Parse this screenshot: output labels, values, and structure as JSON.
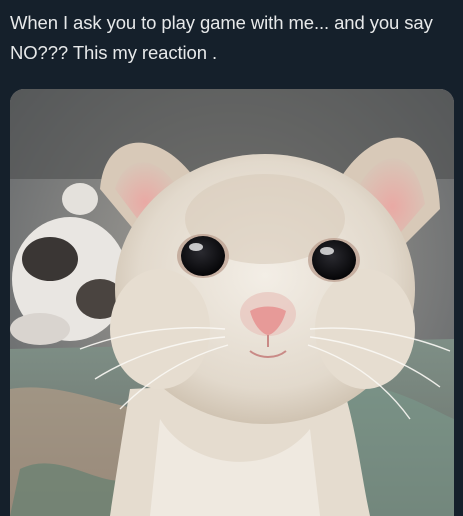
{
  "post": {
    "text": "When I ask you to play game with me... and you say NO??? This my reaction ."
  },
  "media": {
    "subject": "crying-kitten-photo",
    "alt": "",
    "colors": {
      "background": "#15202b",
      "text": "#e7e9ea"
    }
  }
}
